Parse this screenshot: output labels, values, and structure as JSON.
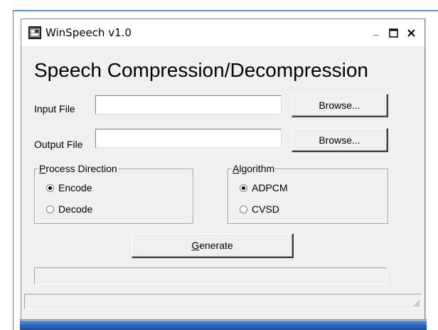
{
  "window": {
    "title": "WinSpeech v1.0",
    "minimize_glyph": "_",
    "maximize_glyph": "□",
    "close_glyph": "✕",
    "app_icon": "winspeech-app-icon"
  },
  "main": {
    "headline": "Speech Compression/Decompression",
    "input_file": {
      "label": "Input File",
      "value": "",
      "browse_label": "Browse..."
    },
    "output_file": {
      "label": "Output File",
      "value": "",
      "browse_label": "Browse..."
    },
    "process_direction": {
      "legend_mnemonic": "P",
      "legend_rest": "rocess Direction",
      "options": [
        {
          "label": "Encode",
          "checked": true
        },
        {
          "label": "Decode",
          "checked": false
        }
      ]
    },
    "algorithm": {
      "legend_mnemonic": "A",
      "legend_rest": "lgorithm",
      "options": [
        {
          "label": "ADPCM",
          "checked": true
        },
        {
          "label": "CVSD",
          "checked": false
        }
      ]
    },
    "generate_button": {
      "mnemonic": "G",
      "rest": "enerate"
    },
    "progress": {
      "fraction": 0
    }
  },
  "colors": {
    "title_accent": "#5b8fd6",
    "window_bg": "#f0f0f0"
  }
}
